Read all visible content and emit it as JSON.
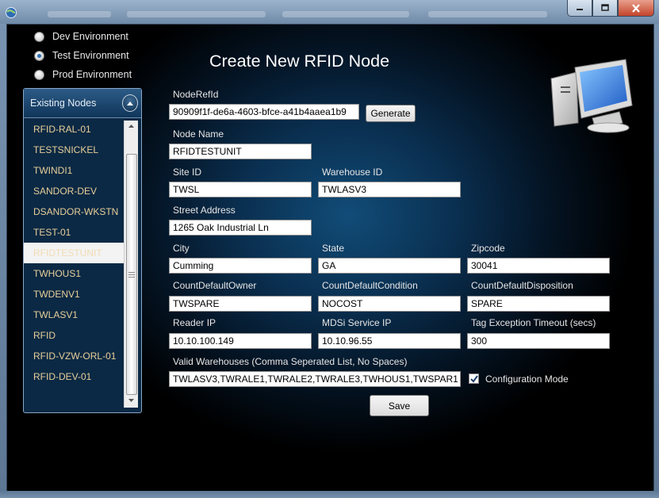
{
  "window": {
    "title": "",
    "controls": {
      "minimize": "—",
      "maximize": "□",
      "close": "✕"
    }
  },
  "environments": {
    "selected": "Test Environment",
    "options": [
      "Dev Environment",
      "Test Environment",
      "Prod Environment"
    ]
  },
  "nodes": {
    "header": "Existing Nodes",
    "selected": "RFIDTESTUNIT",
    "items": [
      "RFID-RAL-01",
      "TESTSNICKEL",
      "TWINDI1",
      "SANDOR-DEV",
      "DSANDOR-WKSTN",
      "TEST-01",
      "RFIDTESTUNIT",
      "TWHOUS1",
      "TWDENV1",
      "TWLASV1",
      "RFID",
      "RFID-VZW-ORL-01",
      "RFID-DEV-01"
    ]
  },
  "form": {
    "title": "Create New RFID Node",
    "node_ref_id": {
      "label": "NodeRefId",
      "value": "90909f1f-de6a-4603-bfce-a41b4aaea1b9"
    },
    "generate_label": "Generate",
    "node_name": {
      "label": "Node Name",
      "value": "RFIDTESTUNIT"
    },
    "site_id": {
      "label": "Site ID",
      "value": "TWSL"
    },
    "warehouse_id": {
      "label": "Warehouse ID",
      "value": "TWLASV3"
    },
    "street_address": {
      "label": "Street Address",
      "value": "1265 Oak Industrial Ln"
    },
    "city": {
      "label": "City",
      "value": "Cumming"
    },
    "state": {
      "label": "State",
      "value": "GA"
    },
    "zipcode": {
      "label": "Zipcode",
      "value": "30041"
    },
    "count_default_owner": {
      "label": "CountDefaultOwner",
      "value": "TWSPARE"
    },
    "count_default_condition": {
      "label": "CountDefaultCondition",
      "value": "NOCOST"
    },
    "count_default_disposition": {
      "label": "CountDefaultDisposition",
      "value": "SPARE"
    },
    "reader_ip": {
      "label": "Reader IP",
      "value": "10.10.100.149"
    },
    "mdsi_service_ip": {
      "label": "MDSi Service IP",
      "value": "10.10.96.55"
    },
    "tag_exception_timeout": {
      "label": "Tag Exception Timeout (secs)",
      "value": "300"
    },
    "valid_warehouses": {
      "label": "Valid Warehouses (Comma Seperated List, No Spaces)",
      "value": "TWLASV3,TWRALE1,TWRALE2,TWRALE3,TWHOUS1,TWSPAR1"
    },
    "configuration_mode": {
      "label": "Configuration Mode",
      "checked": true
    },
    "save_label": "Save"
  },
  "icons": {
    "app": "app-globe-icon",
    "computer": "computer-icon",
    "collapse": "collapse-up-icon"
  },
  "colors": {
    "list_text": "#e8cf9a",
    "panel_border": "#8aa7c6",
    "background_glow": "#114c78"
  }
}
